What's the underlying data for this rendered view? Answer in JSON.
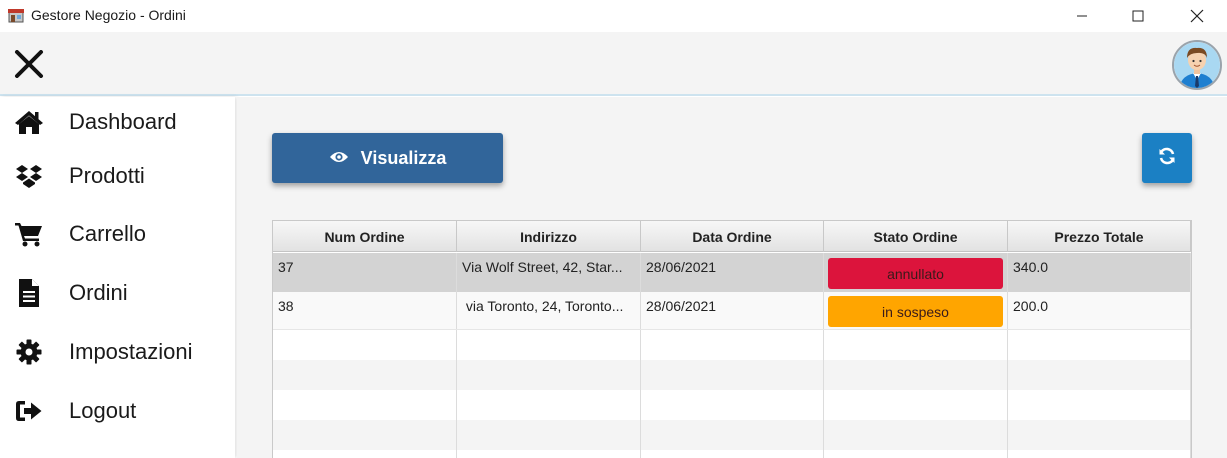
{
  "window": {
    "title": "Gestore Negozio - Ordini"
  },
  "header": {
    "close_icon": "close-icon",
    "avatar": "user-avatar"
  },
  "sidebar": {
    "items": [
      {
        "label": "Dashboard",
        "icon": "home-icon"
      },
      {
        "label": "Prodotti",
        "icon": "dropbox-icon"
      },
      {
        "label": "Carrello",
        "icon": "cart-icon"
      },
      {
        "label": "Ordini",
        "icon": "document-icon"
      },
      {
        "label": "Impostazioni",
        "icon": "gear-icon"
      },
      {
        "label": "Logout",
        "icon": "sign-out-icon"
      }
    ]
  },
  "toolbar": {
    "view_label": "Visualizza",
    "view_icon": "eye-icon",
    "refresh_icon": "refresh-icon"
  },
  "table": {
    "columns": [
      "Num Ordine",
      "Indirizzo",
      "Data Ordine",
      "Stato Ordine",
      "Prezzo Totale"
    ],
    "rows": [
      {
        "num": "37",
        "address": "Via Wolf Street, 42, Star...",
        "date": "28/06/2021",
        "status": "annullato",
        "total": "340.0"
      },
      {
        "num": "38",
        "address": " via Toronto, 24, Toronto...",
        "date": "28/06/2021",
        "status": "in sospeso",
        "total": "200.0"
      }
    ]
  },
  "colors": {
    "primary_button": "#31659a",
    "refresh_button": "#1b80c4",
    "status_cancelled": "#dc143c",
    "status_pending": "#ffa500",
    "selected_row": "#d3d3d3"
  }
}
